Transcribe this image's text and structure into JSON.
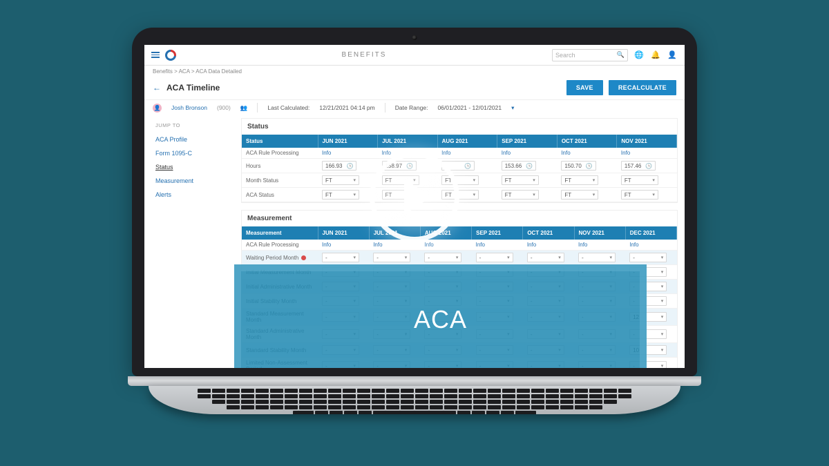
{
  "header": {
    "app_title": "BENEFITS",
    "search_placeholder": "Search"
  },
  "breadcrumb": {
    "a": "Benefits",
    "b": "ACA",
    "c": "ACA Data Detailed"
  },
  "page": {
    "title": "ACA Timeline",
    "save_label": "SAVE",
    "recalc_label": "RECALCULATE"
  },
  "employee": {
    "name": "Josh Bronson",
    "id": "(900)",
    "last_calculated_label": "Last Calculated:",
    "last_calculated_value": "12/21/2021 04:14 pm",
    "date_range_label": "Date Range:",
    "date_range_value": "06/01/2021 - 12/01/2021"
  },
  "sidebar": {
    "heading": "JUMP TO",
    "items": [
      "ACA Profile",
      "Form 1095-C",
      "Status",
      "Measurement",
      "Alerts"
    ],
    "active_index": 2
  },
  "status": {
    "title": "Status",
    "columns": [
      "Status",
      "JUN 2021",
      "JUL 2021",
      "AUG 2021",
      "SEP 2021",
      "OCT 2021",
      "NOV 2021"
    ],
    "rows": {
      "rule": {
        "label": "ACA Rule Processing",
        "link": "Info"
      },
      "hours": {
        "label": "Hours",
        "values": [
          "166.93",
          "158.97",
          "",
          "153.66",
          "150.70",
          "157.46"
        ]
      },
      "month_status": {
        "label": "Month Status",
        "value": "FT"
      },
      "aca_status": {
        "label": "ACA Status",
        "value": "FT"
      }
    }
  },
  "measurement": {
    "title": "Measurement",
    "columns": [
      "Measurement",
      "JUN 2021",
      "JUL 2021",
      "AUG 2021",
      "SEP 2021",
      "OCT 2021",
      "NOV 2021",
      "DEC 2021"
    ],
    "rows": [
      {
        "label": "ACA Rule Processing",
        "type": "link",
        "link": "Info"
      },
      {
        "label": "Waiting Period Month",
        "type": "select",
        "value": "-",
        "dot": true
      },
      {
        "label": "Initial Measurement Month",
        "type": "select",
        "value": "-"
      },
      {
        "label": "Initial Administrative Month",
        "type": "select",
        "value": "-"
      },
      {
        "label": "Initial Stability Month",
        "type": "select",
        "value": "-"
      },
      {
        "label": "Standard Measurement Month",
        "type": "select",
        "value": "-",
        "dec": "12"
      },
      {
        "label": "Standard Administrative Month",
        "type": "select",
        "value": "-"
      },
      {
        "label": "Standard Stability Month",
        "type": "select",
        "value": "-",
        "dec": "10"
      },
      {
        "label": "Limited Non-Assessment Period",
        "type": "select",
        "value": "-"
      }
    ]
  },
  "overlay": {
    "banner_text": "ACA"
  }
}
